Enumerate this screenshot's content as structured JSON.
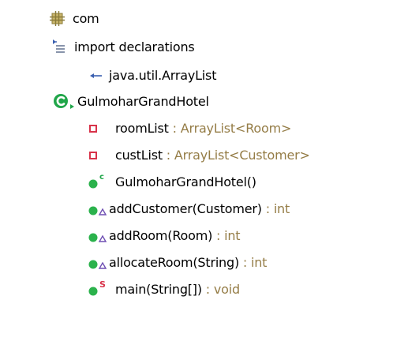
{
  "outline": {
    "package": {
      "label": "com",
      "icon": "package-icon"
    },
    "imports": {
      "label": "import declarations",
      "icon": "import-declarations-icon",
      "items": [
        {
          "label": "java.util.ArrayList",
          "icon": "import-icon"
        }
      ]
    },
    "class": {
      "label": "GulmoharGrandHotel",
      "icon": "public-class-icon",
      "members": [
        {
          "name": "roomList",
          "type": "ArrayList<Room>",
          "icon": "private-field-icon"
        },
        {
          "name": "custList",
          "type": "ArrayList<Customer>",
          "icon": "private-field-icon"
        },
        {
          "name": "GulmoharGrandHotel()",
          "type": "",
          "icon": "public-constructor-icon"
        },
        {
          "name": "addCustomer(Customer)",
          "type": "int",
          "icon": "public-method-icon"
        },
        {
          "name": "addRoom(Room)",
          "type": "int",
          "icon": "public-method-icon"
        },
        {
          "name": "allocateRoom(String)",
          "type": "int",
          "icon": "public-method-icon"
        },
        {
          "name": "main(String[])",
          "type": "void",
          "icon": "public-static-method-icon"
        }
      ]
    }
  },
  "colors": {
    "type_text": "#957d47",
    "package_icon": "#c9b56b",
    "class_icon": "#21a64a",
    "method_icon": "#2bb24c",
    "field_icon": "#d8334a",
    "default_marker": "#6f4fb3"
  }
}
